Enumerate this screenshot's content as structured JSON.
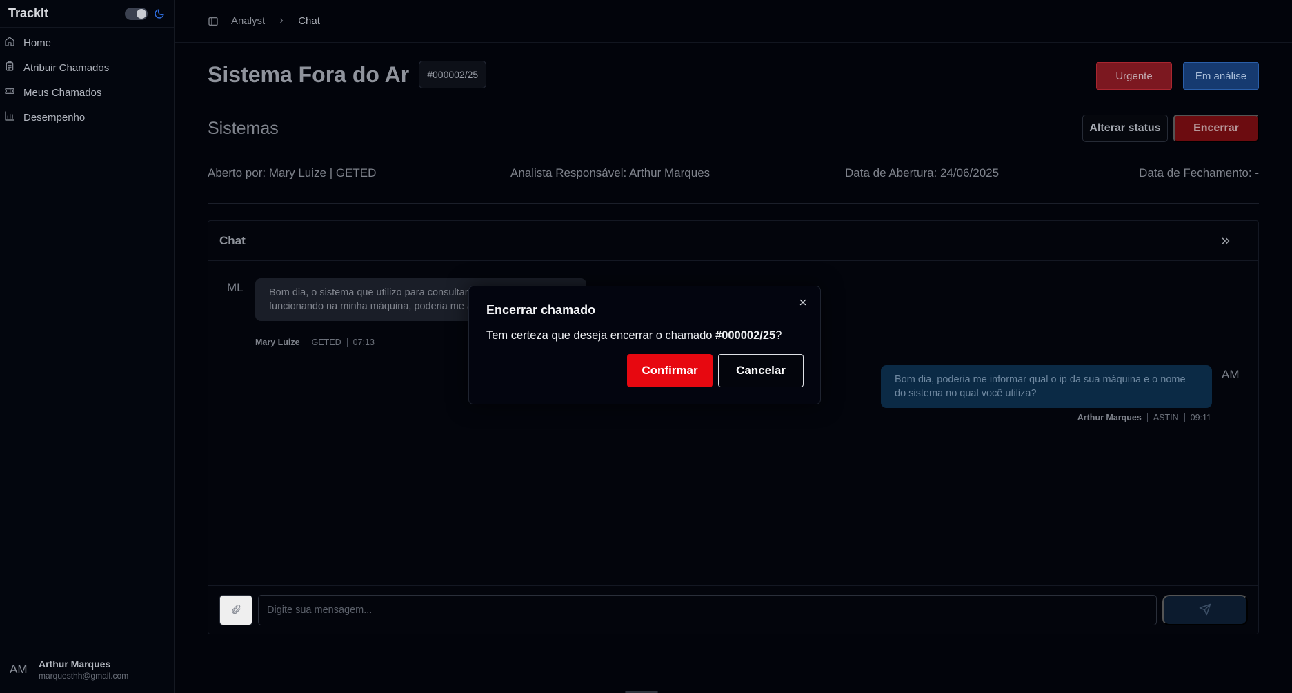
{
  "sidebar": {
    "brand": "TrackIt",
    "items": [
      {
        "label": "Home",
        "icon": "home-icon"
      },
      {
        "label": "Atribuir Chamados",
        "icon": "clipboard-icon"
      },
      {
        "label": "Meus Chamados",
        "icon": "ticket-icon"
      },
      {
        "label": "Desempenho",
        "icon": "bar-chart-icon"
      }
    ],
    "user": {
      "initials": "AM",
      "name": "Arthur Marques",
      "email": "marquesthh@gmail.com"
    }
  },
  "breadcrumb": {
    "parent": "Analyst",
    "current": "Chat"
  },
  "ticket": {
    "title": "Sistema Fora do Ar",
    "id": "#000002/25",
    "priority": "Urgente",
    "status": "Em análise",
    "category": "Sistemas",
    "opened_by": "Aberto por: Mary Luize | GETED",
    "analyst": "Analista Responsável: Arthur Marques",
    "opened_date": "Data de Abertura: 24/06/2025",
    "closed_date": "Data de Fechamento: -"
  },
  "actions": {
    "change_status": "Alterar status",
    "close": "Encerrar"
  },
  "chat": {
    "title": "Chat",
    "messages": [
      {
        "initials": "ML",
        "text": "Bom dia, o sistema que utilizo para consultar fornecedores não está funcionando na minha máquina, poderia me ajudar com isso?",
        "author": "Mary Luize",
        "department": "GETED",
        "time": "07:13"
      },
      {
        "initials": "AM",
        "text": "Bom dia, poderia me informar qual o ip da sua máquina e o nome do sistema no qual você utiliza?",
        "author": "Arthur Marques",
        "department": "ASTIN",
        "time": "09:11"
      }
    ],
    "input_placeholder": "Digite sua mensagem..."
  },
  "modal": {
    "title": "Encerrar chamado",
    "text_prefix": "Tem certeza que deseja encerrar o chamado ",
    "ticket_id": "#000002/25",
    "text_suffix": "?",
    "confirm": "Confirmar",
    "cancel": "Cancelar"
  },
  "colors": {
    "urgent": "#7c1820",
    "status": "#163a70",
    "confirm": "#e70810",
    "accent_moon": "#2f6fe4"
  }
}
